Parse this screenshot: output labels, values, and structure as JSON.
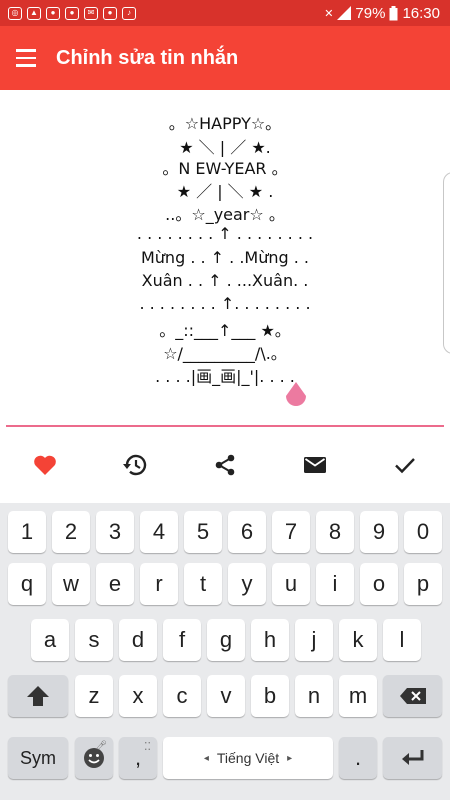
{
  "status_bar": {
    "battery": "79%",
    "time": "16:30"
  },
  "app_bar": {
    "title": "Chỉnh sửa tin nhắn"
  },
  "message": {
    "lines": [
      "。☆HAPPY☆。",
      "★ ＼ | ／ ★.",
      "。N EW-YEAR 。",
      "★ ／ | ＼ ★ .",
      "..。☆_year☆ 。",
      ". . . . . . . . ↑ . . . . . . . .",
      "Mừng . . ↑ . .Mừng . .",
      "Xuân . . ↑ . ...Xuân. .",
      ". . . . . . . . ↑. . . . . . . .",
      "。_::___↑___ ★。",
      "☆/_________/\\.。",
      ". . . .|画_画|_'|. . . ."
    ]
  },
  "actions": [
    "favorite-icon",
    "history-icon",
    "share-icon",
    "email-icon",
    "check-icon"
  ],
  "keyboard": {
    "numbers": [
      "1",
      "2",
      "3",
      "4",
      "5",
      "6",
      "7",
      "8",
      "9",
      "0"
    ],
    "row1": [
      "q",
      "w",
      "e",
      "r",
      "t",
      "y",
      "u",
      "i",
      "o",
      "p"
    ],
    "row2": [
      "a",
      "s",
      "d",
      "f",
      "g",
      "h",
      "j",
      "k",
      "l"
    ],
    "row3": [
      "z",
      "x",
      "c",
      "v",
      "b",
      "n",
      "m"
    ],
    "sym": "Sym",
    "comma": ",",
    "period": ".",
    "space": "Tiếng Việt"
  },
  "colors": {
    "status_bar": "#d8322b",
    "app_bar": "#f44336",
    "accent_pink": "#ec6b8c",
    "heart": "#f44336"
  }
}
